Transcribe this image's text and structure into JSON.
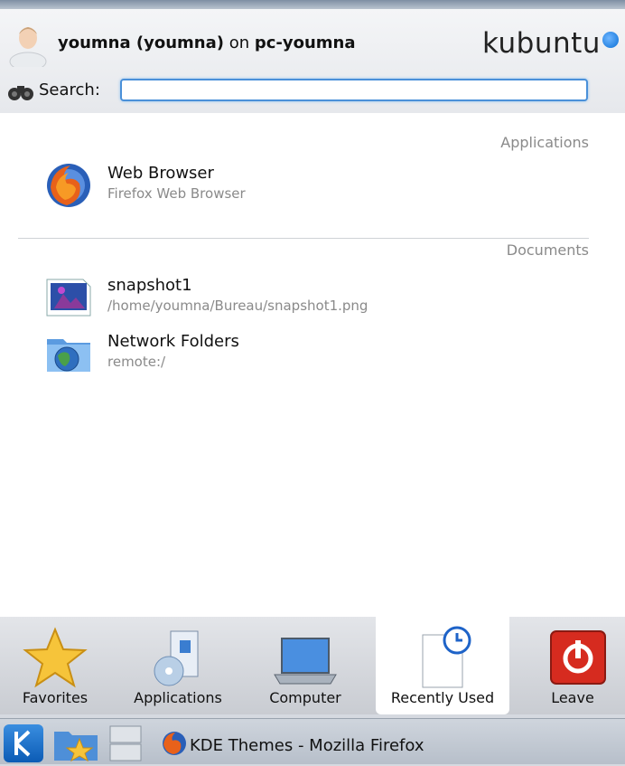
{
  "header": {
    "user_name": "youmna (youmna)",
    "on_word": " on ",
    "host_name": "pc-youmna",
    "logo_text": "kubuntu"
  },
  "search": {
    "label": "Search:",
    "value": "",
    "placeholder": ""
  },
  "sections": {
    "applications_header": "Applications",
    "documents_header": "Documents"
  },
  "applications": [
    {
      "title": "Web Browser",
      "subtitle": "Firefox Web Browser",
      "icon": "firefox-icon"
    }
  ],
  "documents": [
    {
      "title": "snapshot1",
      "subtitle": "/home/youmna/Bureau/snapshot1.png",
      "icon": "image-file-icon"
    },
    {
      "title": "Network Folders",
      "subtitle": "remote:/",
      "icon": "network-folder-icon"
    }
  ],
  "tabs": [
    {
      "label": "Favorites",
      "icon": "star-icon",
      "active": false
    },
    {
      "label": "Applications",
      "icon": "applications-icon",
      "active": false
    },
    {
      "label": "Computer",
      "icon": "laptop-icon",
      "active": false
    },
    {
      "label": "Recently Used",
      "icon": "clock-document-icon",
      "active": true
    },
    {
      "label": "Leave",
      "icon": "power-icon",
      "active": false
    }
  ],
  "taskbar": {
    "window_title": "KDE Themes - Mozilla Firefox"
  },
  "colors": {
    "accent": "#4a90d9",
    "leave_red": "#d62b1f",
    "secondary_text": "#8a8a8a"
  }
}
